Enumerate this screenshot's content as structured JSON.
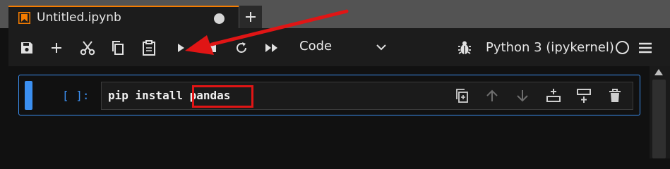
{
  "tab": {
    "title": "Untitled.ipynb",
    "icon": "notebook-icon",
    "unsaved_icon": "unsaved-dot-icon",
    "new_tab_icon": "plus-icon"
  },
  "toolbar": {
    "buttons": [
      {
        "name": "save",
        "icon": "save-icon"
      },
      {
        "name": "insert-cell",
        "icon": "plus-icon"
      },
      {
        "name": "cut",
        "icon": "scissors-icon"
      },
      {
        "name": "copy",
        "icon": "copy-icon"
      },
      {
        "name": "paste",
        "icon": "clipboard-icon"
      },
      {
        "name": "run",
        "icon": "play-icon"
      },
      {
        "name": "interrupt",
        "icon": "stop-icon"
      },
      {
        "name": "restart",
        "icon": "restart-icon"
      },
      {
        "name": "run-all",
        "icon": "fast-forward-icon"
      }
    ],
    "cell_type": "Code",
    "kernel": "Python 3 (ipykernel)"
  },
  "cell": {
    "prompt": "[ ]:",
    "code_prefix": "pip install ",
    "code_highlight": "pandas",
    "tools": [
      "duplicate-cell-icon",
      "move-up-icon",
      "move-down-icon",
      "insert-above-icon",
      "insert-below-icon",
      "delete-icon"
    ]
  },
  "colors": {
    "accent": "#3b8ff0",
    "tab_accent": "#f57c00",
    "annotation": "#e01515"
  }
}
